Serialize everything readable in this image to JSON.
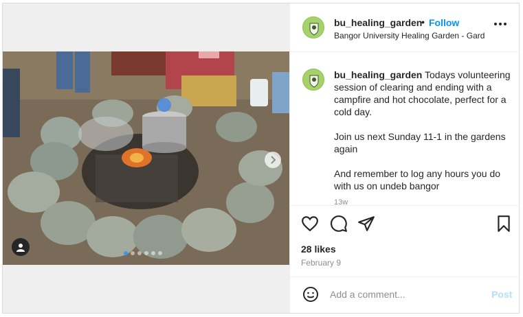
{
  "post": {
    "username": "bu_healing_garden",
    "separator": "•",
    "follow_label": "Follow",
    "location": "Bangor University Healing Garden - Gardе",
    "caption_user": "bu_healing_garden",
    "caption_text": "Todays volunteering session of clearing and ending with a campfire and hot chocolate, perfect for a cold day.\n\nJoin us next Sunday 11-1 in the gardens again\n\nAnd remember to log any hours you do with us on undeb bangor",
    "age": "13w",
    "likes": "28 likes",
    "date": "February 9",
    "comment_placeholder": "Add a comment...",
    "post_label": "Post"
  },
  "icons": {
    "more": "more-horizontal-icon",
    "like": "heart-icon",
    "comment": "comment-bubble-icon",
    "share": "paper-plane-icon",
    "save": "bookmark-icon",
    "emoji": "smiley-icon",
    "tag": "user-tag-icon",
    "next": "chevron-right-icon"
  },
  "carousel": {
    "slides": 6,
    "active_index": 0
  },
  "colors": {
    "follow": "#0095f6",
    "post_disabled": "#b2dffc",
    "avatar": "#a5d26a"
  }
}
